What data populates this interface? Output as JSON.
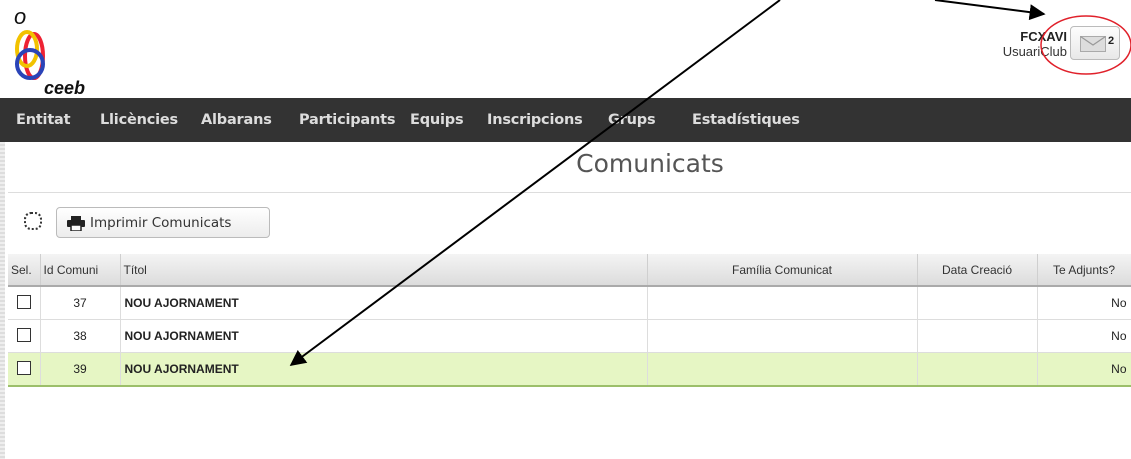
{
  "header": {
    "user_name": "FCXAVI",
    "user_role": "UsuariClub",
    "message_count": "2",
    "logo_text": "ceeb"
  },
  "nav": {
    "items": [
      "Entitat",
      "Llicències",
      "Albarans",
      "Participants",
      "Equips",
      "Inscripcions",
      "Grups",
      "Estadístiques"
    ]
  },
  "page": {
    "title": "Comunicats",
    "print_button": "Imprimir Comunicats"
  },
  "table": {
    "columns": [
      "Sel.",
      "Id Comuni",
      "Títol",
      "Família Comunicat",
      "Data Creació",
      "Te Adjunts?"
    ],
    "rows": [
      {
        "id": "37",
        "title": "NOU AJORNAMENT",
        "family": "",
        "date": "",
        "attachments": "No",
        "selected": false
      },
      {
        "id": "38",
        "title": "NOU AJORNAMENT",
        "family": "",
        "date": "",
        "attachments": "No",
        "selected": false
      },
      {
        "id": "39",
        "title": "NOU AJORNAMENT",
        "family": "",
        "date": "",
        "attachments": "No",
        "selected": true
      }
    ]
  },
  "colors": {
    "nav_bg": "#333333",
    "selected_row": "#e6f6c4",
    "annotation_circle": "#e0202a"
  }
}
